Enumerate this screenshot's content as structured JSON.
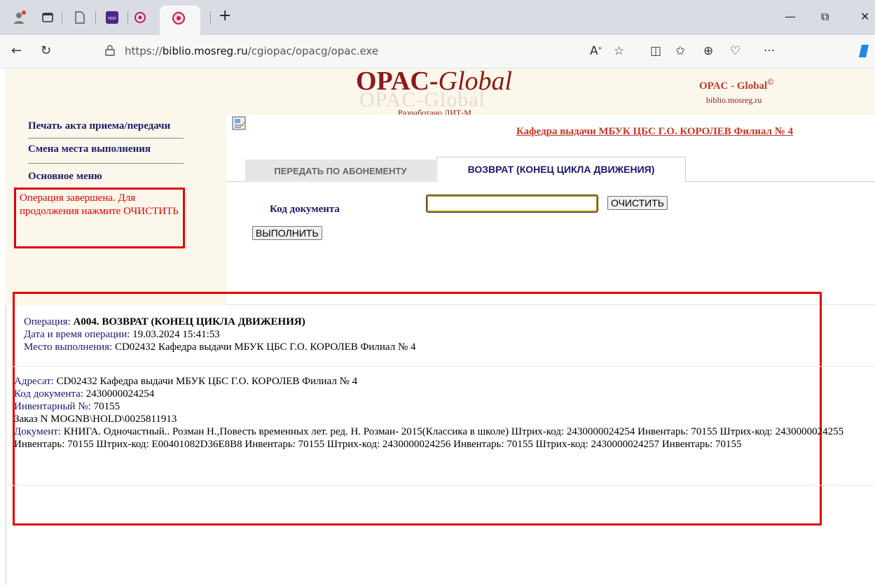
{
  "browser": {
    "url_prefix": "https://",
    "url_host": "biblio.mosreg.ru",
    "url_path": "/cgiopac/opacg/opac.exe",
    "tab_new_symbol": "+",
    "win_min": "—",
    "win_restore": "⧉",
    "win_close": "✕",
    "more_menu": "···"
  },
  "header": {
    "logo_opac": "OPAC-",
    "logo_global": "Global",
    "logo_ghost": "OPAC-Global",
    "logo_sub": "Разработано ЛИТ-М",
    "right_title": "OPAC - Global",
    "right_title_mark": "©",
    "right_sub": "biblio.mosreg.ru"
  },
  "sidebar": {
    "items": [
      {
        "label": "Печать акта приема/передачи"
      },
      {
        "label": "Смена места выполнения"
      },
      {
        "label": "Основное меню"
      }
    ],
    "status_message": "Операция завершена. Для продолжения нажмите ОЧИСТИТЬ"
  },
  "main": {
    "department_link": "Кафедра выдачи МБУК ЦБС Г.О. КОРОЛЕВ Филиал № 4",
    "tabs": [
      {
        "label": "ПЕРЕДАТЬ ПО АБОНЕМЕНТУ",
        "active": false
      },
      {
        "label": "ВОЗВРАТ (КОНЕЦ ЦИКЛА ДВИЖЕНИЯ)",
        "active": true
      }
    ],
    "field_label": "Код документа",
    "field_value": "",
    "clear_button": "ОЧИСТИТЬ",
    "execute_button": "ВЫПОЛНИТЬ"
  },
  "result": {
    "operation_label": "Операция:",
    "operation_value": "A004. ВОЗВРАТ (КОНЕЦ ЦИКЛА ДВИЖЕНИЯ)",
    "datetime_label": "Дата и время операции:",
    "datetime_value": "19.03.2024 15:41:53",
    "place_label": "Место выполнения:",
    "place_value": "CD02432 Кафедра выдачи МБУК ЦБС Г.О. КОРОЛЕВ Филиал № 4",
    "addressee_label": "Адресат:",
    "addressee_value": "CD02432 Кафедра выдачи МБУК ЦБС Г.О. КОРОЛЕВ Филиал № 4",
    "code_label": "Код документа:",
    "code_value": "2430000024254",
    "inv_label": "Инвентарный №:",
    "inv_value": "70155",
    "order_line": "Заказ N MOGNB\\HOLD\\0025811913",
    "document_label": "Документ:",
    "document_value": "КНИГА. Одночастный.. Розман Н.,Повесть временных лет. ред. Н. Розман- 2015(Классика в школе) Штрих-код: 2430000024254 Инвентарь: 70155 Штрих-код: 2430000024255 Инвентарь: 70155 Штрих-код: E00401082D36E8B8 Инвентарь: 70155 Штрих-код: 2430000024256 Инвентарь: 70155 Штрих-код: 2430000024257 Инвентарь: 70155"
  }
}
